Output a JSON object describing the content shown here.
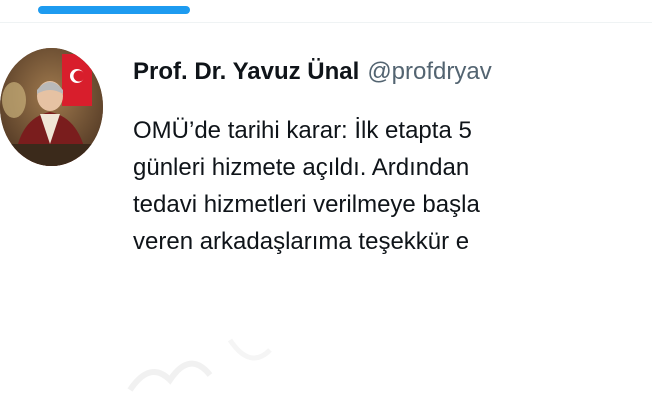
{
  "tweet": {
    "author": {
      "display_name": "Prof. Dr. Yavuz Ünal",
      "handle": "@profdryav"
    },
    "lines": [
      "OMÜ’de tarihi karar: İlk etapta 5",
      "günleri hizmete açıldı. Ardından",
      "tedavi hizmetleri verilmeye başla",
      "veren arkadaşlarıma teşekkür e"
    ]
  },
  "colors": {
    "accent": "#1d9bf0",
    "name_text": "#0f1419",
    "handle_text": "#536471",
    "divider": "#eff3f4"
  },
  "icons": {
    "avatar": "profile-photo"
  }
}
